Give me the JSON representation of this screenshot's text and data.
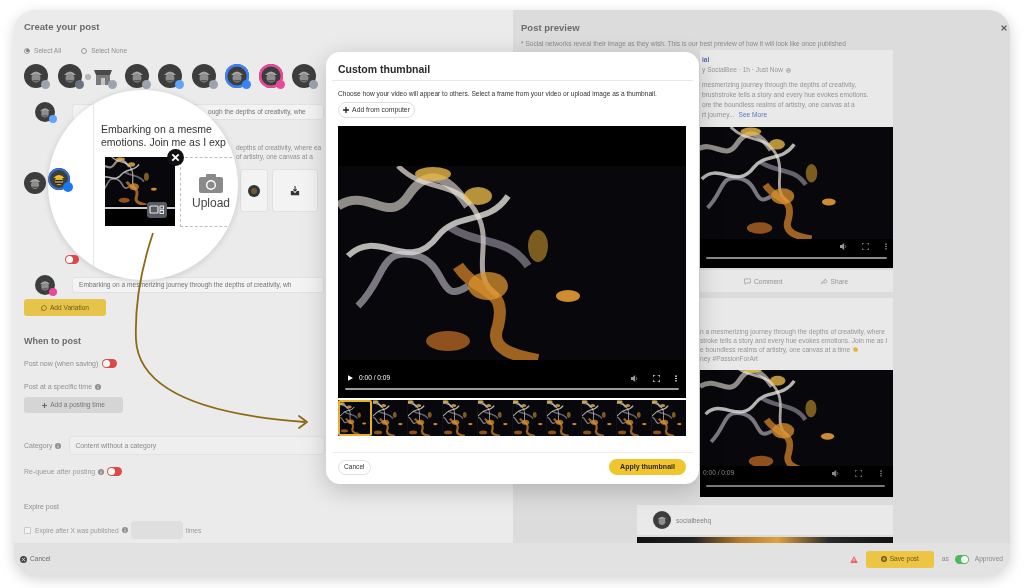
{
  "composer": {
    "title": "Create your post",
    "select_options": [
      {
        "label": "Select All",
        "selected": true
      },
      {
        "label": "Select None",
        "selected": false
      }
    ],
    "accounts": [
      {
        "kind": "logo",
        "color": "#9ca3af",
        "selected": false
      },
      {
        "kind": "logo",
        "color": "#6b7280",
        "selected": false
      },
      {
        "kind": "store",
        "color": "#9ca3af",
        "selected": false
      },
      {
        "kind": "logo",
        "color": "#9ca3af",
        "selected": false
      },
      {
        "kind": "logo",
        "color": "#60a5fa",
        "selected": false
      },
      {
        "kind": "logo",
        "color": "#9ca3af",
        "selected": false
      },
      {
        "kind": "logo",
        "color": "#3b82f6",
        "selected": true
      },
      {
        "kind": "logo",
        "color": "#ec4899",
        "selected": true
      },
      {
        "kind": "logo",
        "color": "#9ca3af",
        "selected": false
      }
    ],
    "variations": [
      {
        "kind": "text",
        "color": "#60a5fa",
        "text": "ough the depths of creativity, whe"
      },
      {
        "kind": "media",
        "color": "#1877f2",
        "lines": [
          "depths of creativity, where ea",
          "of artistry, one canvas at a"
        ],
        "on": false
      },
      {
        "kind": "text",
        "color": "#ec4899",
        "text": "Embarking on a mesmerizing journey through the depths of creativity, wh"
      }
    ],
    "add_variation": "Add Variation",
    "schedule": {
      "title": "When to post",
      "post_now": {
        "label": "Post now (when saving)",
        "on": false
      },
      "specific_time": "Post at a specific time",
      "add_time": "Add a posting time"
    },
    "category": {
      "label": "Category",
      "value": "Content without a category"
    },
    "requeue": {
      "label": "Re-queue after posting",
      "on": false
    },
    "expire": {
      "title": "Expire post",
      "label": "Expire after X was published",
      "checked": false,
      "suffix": "times"
    }
  },
  "magnifier": {
    "lines": [
      "Embarking on a mesme",
      "emotions. Join me as I exp"
    ],
    "upload": "Upload"
  },
  "thumbnail_dialog": {
    "title": "Custom thumbnail",
    "description": "Choose how your video will appear to others. Select a frame from your video or upload image as a thumbnail.",
    "add_button": "Add from computer",
    "time": "0:00 / 0:09",
    "frames": [
      {
        "selected": true
      },
      {
        "selected": false
      },
      {
        "selected": false
      },
      {
        "selected": false
      },
      {
        "selected": false
      },
      {
        "selected": false
      },
      {
        "selected": false
      },
      {
        "selected": false
      },
      {
        "selected": false
      },
      {
        "selected": false
      }
    ],
    "cancel": "Cancel",
    "apply": "Apply thumbnail"
  },
  "preview": {
    "title": "Post preview",
    "note": "* Social networks reveal their image as they wish. This is our best preview of how it will look like once published",
    "feed_card": {
      "name": "ial",
      "meta": "y SocialBee · 1h · Just Now",
      "lines": [
        "mesmerizing journey through the depths of creativity,",
        "brushstroke tells a story and every hue evokes emotions.",
        "ore the boundless realms of artistry, one canvas at a",
        "rt journey..."
      ],
      "link": "See More",
      "actions": [
        {
          "kind": "comment",
          "label": "Comment"
        },
        {
          "kind": "share",
          "label": "Share"
        }
      ]
    },
    "reel_card": {
      "lines": [
        "n a mesmerizing journey through the depths of creativity, where",
        "stroke tells a story and every hue evokes emotions. Join me as I",
        "e boundless realms of artistry, one canvas at a time",
        "ney #PassionForArt"
      ],
      "time": "0:00 / 0:09"
    },
    "profile_card": {
      "username": "socialbeehq"
    }
  },
  "footer": {
    "cancel": "Cancel",
    "save": "Save post",
    "as_label": "as",
    "approval": {
      "label": "Approved",
      "on": true
    }
  }
}
